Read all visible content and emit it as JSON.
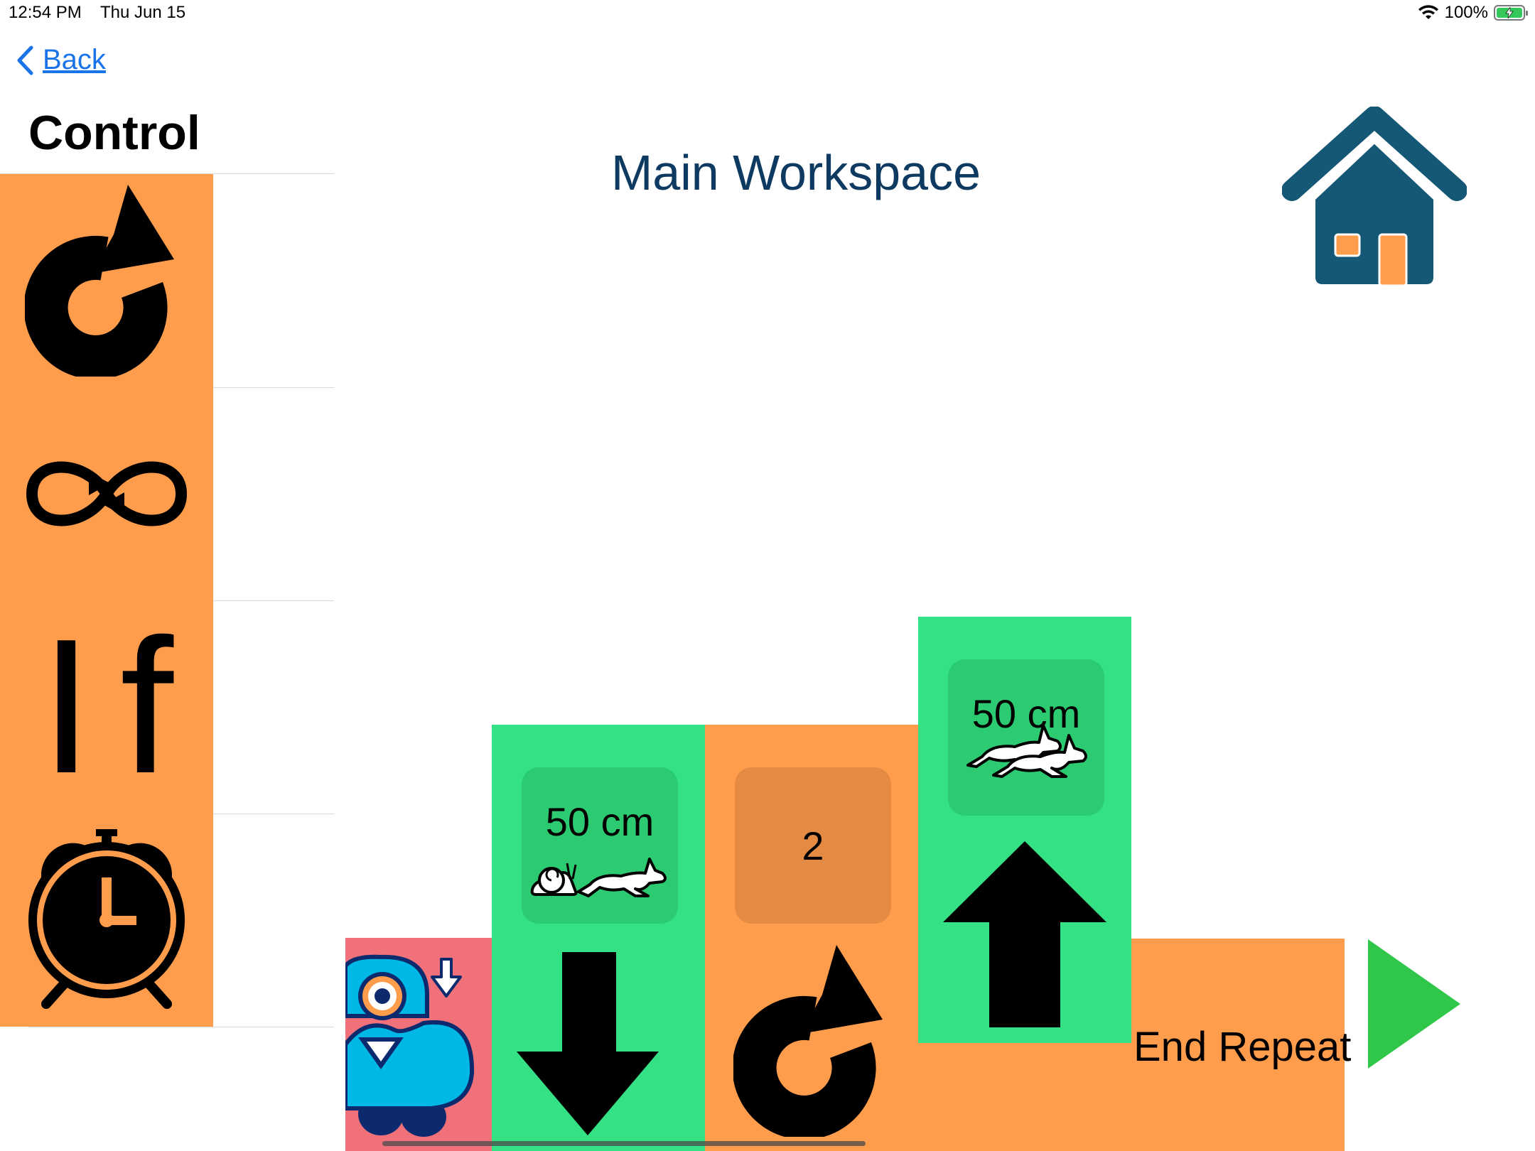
{
  "status": {
    "time": "12:54 PM",
    "date": "Thu Jun 15",
    "battery": "100%"
  },
  "nav": {
    "back_label": "Back",
    "section_title": "Control"
  },
  "palette": {
    "items": [
      {
        "name": "repeat",
        "icon": "repeat-arrow-icon"
      },
      {
        "name": "forever",
        "icon": "infinity-loop-icon"
      },
      {
        "name": "if",
        "label": "If"
      },
      {
        "name": "wait",
        "icon": "alarm-clock-icon"
      }
    ]
  },
  "workspace": {
    "title": "Main Workspace",
    "blocks": [
      {
        "name": "start",
        "icon": "robot-start-icon"
      },
      {
        "name": "move-backward",
        "distance_label": "50 cm",
        "speed": "medium",
        "icon": "down-arrow-icon"
      },
      {
        "name": "repeat",
        "count_label": "2",
        "icon": "repeat-arrow-icon"
      },
      {
        "name": "move-forward",
        "distance_label": "50 cm",
        "speed": "fast",
        "icon": "up-arrow-icon"
      }
    ],
    "end_repeat_label": "End Repeat"
  },
  "colors": {
    "control_orange": "#ff9d4c",
    "motion_green": "#34e285",
    "start_pink": "#f0717a",
    "title_blue": "#0e3a62",
    "home_blue": "#155875",
    "play_green": "#2fc64a",
    "link_blue": "#1a73e8"
  }
}
